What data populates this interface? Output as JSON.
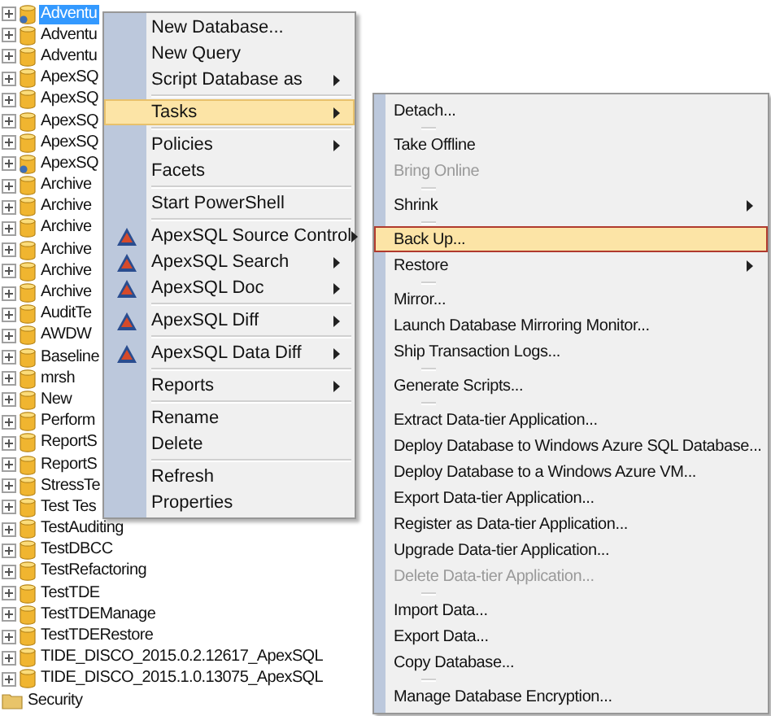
{
  "tree": [
    {
      "label": "Adventu",
      "kind": "database-linked",
      "selected": true
    },
    {
      "label": "Adventu",
      "kind": "database",
      "selected": false
    },
    {
      "label": "Adventu",
      "kind": "database",
      "selected": false
    },
    {
      "label": "ApexSQ",
      "kind": "database",
      "selected": false
    },
    {
      "label": "ApexSQ",
      "kind": "database",
      "selected": false
    },
    {
      "label": "ApexSQ",
      "kind": "database",
      "selected": false
    },
    {
      "label": "ApexSQ",
      "kind": "database",
      "selected": false
    },
    {
      "label": "ApexSQ",
      "kind": "database-linked",
      "selected": false
    },
    {
      "label": "Archive",
      "kind": "database",
      "selected": false
    },
    {
      "label": "Archive",
      "kind": "database",
      "selected": false
    },
    {
      "label": "Archive",
      "kind": "database",
      "selected": false
    },
    {
      "label": "Archive",
      "kind": "database",
      "selected": false
    },
    {
      "label": "Archive",
      "kind": "database",
      "selected": false
    },
    {
      "label": "Archive",
      "kind": "database",
      "selected": false
    },
    {
      "label": "AuditTe",
      "kind": "database",
      "selected": false
    },
    {
      "label": "AWDW",
      "kind": "database",
      "selected": false
    },
    {
      "label": "Baseline",
      "kind": "database",
      "selected": false
    },
    {
      "label": "mrsh",
      "kind": "database",
      "selected": false
    },
    {
      "label": "New",
      "kind": "database",
      "selected": false
    },
    {
      "label": "Perform",
      "kind": "database",
      "selected": false
    },
    {
      "label": "ReportS",
      "kind": "database",
      "selected": false
    },
    {
      "label": "ReportS",
      "kind": "database",
      "selected": false
    },
    {
      "label": "StressTe",
      "kind": "database",
      "selected": false
    },
    {
      "label": "Test Tes",
      "kind": "database",
      "selected": false
    },
    {
      "label": "TestAuditing",
      "kind": "database",
      "selected": false
    },
    {
      "label": "TestDBCC",
      "kind": "database",
      "selected": false
    },
    {
      "label": "TestRefactoring",
      "kind": "database",
      "selected": false
    },
    {
      "label": "TestTDE",
      "kind": "database",
      "selected": false
    },
    {
      "label": "TestTDEManage",
      "kind": "database",
      "selected": false
    },
    {
      "label": "TestTDERestore",
      "kind": "database",
      "selected": false
    },
    {
      "label": "TIDE_DISCO_2015.0.2.12617_ApexSQL",
      "kind": "database",
      "selected": false
    },
    {
      "label": "TIDE_DISCO_2015.1.0.13075_ApexSQL",
      "kind": "database",
      "selected": false
    },
    {
      "label": "Security",
      "kind": "folder",
      "selected": false
    }
  ],
  "context_menu": [
    {
      "kind": "item",
      "label": "New Database...",
      "submenu": false,
      "selected": false,
      "disabled": false,
      "icon": false
    },
    {
      "kind": "item",
      "label": "New Query",
      "submenu": false,
      "selected": false,
      "disabled": false,
      "icon": false
    },
    {
      "kind": "item",
      "label": "Script Database as",
      "submenu": true,
      "selected": false,
      "disabled": false,
      "icon": false
    },
    {
      "kind": "separator"
    },
    {
      "kind": "item",
      "label": "Tasks",
      "submenu": true,
      "selected": true,
      "disabled": false,
      "icon": false
    },
    {
      "kind": "separator"
    },
    {
      "kind": "item",
      "label": "Policies",
      "submenu": true,
      "selected": false,
      "disabled": false,
      "icon": false
    },
    {
      "kind": "item",
      "label": "Facets",
      "submenu": false,
      "selected": false,
      "disabled": false,
      "icon": false
    },
    {
      "kind": "separator"
    },
    {
      "kind": "item",
      "label": "Start PowerShell",
      "submenu": false,
      "selected": false,
      "disabled": false,
      "icon": false
    },
    {
      "kind": "separator"
    },
    {
      "kind": "item",
      "label": "ApexSQL Source Control",
      "submenu": true,
      "selected": false,
      "disabled": false,
      "icon": true
    },
    {
      "kind": "item",
      "label": "ApexSQL Search",
      "submenu": true,
      "selected": false,
      "disabled": false,
      "icon": true
    },
    {
      "kind": "item",
      "label": "ApexSQL Doc",
      "submenu": true,
      "selected": false,
      "disabled": false,
      "icon": true
    },
    {
      "kind": "separator"
    },
    {
      "kind": "item",
      "label": "ApexSQL Diff",
      "submenu": true,
      "selected": false,
      "disabled": false,
      "icon": true
    },
    {
      "kind": "separator"
    },
    {
      "kind": "item",
      "label": "ApexSQL Data Diff",
      "submenu": true,
      "selected": false,
      "disabled": false,
      "icon": true
    },
    {
      "kind": "separator"
    },
    {
      "kind": "item",
      "label": "Reports",
      "submenu": true,
      "selected": false,
      "disabled": false,
      "icon": false
    },
    {
      "kind": "separator"
    },
    {
      "kind": "item",
      "label": "Rename",
      "submenu": false,
      "selected": false,
      "disabled": false,
      "icon": false
    },
    {
      "kind": "item",
      "label": "Delete",
      "submenu": false,
      "selected": false,
      "disabled": false,
      "icon": false
    },
    {
      "kind": "separator"
    },
    {
      "kind": "item",
      "label": "Refresh",
      "submenu": false,
      "selected": false,
      "disabled": false,
      "icon": false
    },
    {
      "kind": "item",
      "label": "Properties",
      "submenu": false,
      "selected": false,
      "disabled": false,
      "icon": false
    }
  ],
  "tasks_submenu": [
    {
      "kind": "item",
      "label": "Detach...",
      "submenu": false,
      "selected": false,
      "disabled": false
    },
    {
      "kind": "separator"
    },
    {
      "kind": "item",
      "label": "Take Offline",
      "submenu": false,
      "selected": false,
      "disabled": false
    },
    {
      "kind": "item",
      "label": "Bring Online",
      "submenu": false,
      "selected": false,
      "disabled": true
    },
    {
      "kind": "separator"
    },
    {
      "kind": "item",
      "label": "Shrink",
      "submenu": true,
      "selected": false,
      "disabled": false
    },
    {
      "kind": "separator"
    },
    {
      "kind": "item",
      "label": "Back Up...",
      "submenu": false,
      "selected": true,
      "disabled": false
    },
    {
      "kind": "item",
      "label": "Restore",
      "submenu": true,
      "selected": false,
      "disabled": false
    },
    {
      "kind": "separator"
    },
    {
      "kind": "item",
      "label": "Mirror...",
      "submenu": false,
      "selected": false,
      "disabled": false
    },
    {
      "kind": "item",
      "label": "Launch Database Mirroring Monitor...",
      "submenu": false,
      "selected": false,
      "disabled": false
    },
    {
      "kind": "item",
      "label": "Ship Transaction Logs...",
      "submenu": false,
      "selected": false,
      "disabled": false
    },
    {
      "kind": "separator"
    },
    {
      "kind": "item",
      "label": "Generate Scripts...",
      "submenu": false,
      "selected": false,
      "disabled": false
    },
    {
      "kind": "separator"
    },
    {
      "kind": "item",
      "label": "Extract Data-tier Application...",
      "submenu": false,
      "selected": false,
      "disabled": false
    },
    {
      "kind": "item",
      "label": "Deploy Database to Windows Azure SQL Database...",
      "submenu": false,
      "selected": false,
      "disabled": false
    },
    {
      "kind": "item",
      "label": "Deploy Database to a Windows Azure VM...",
      "submenu": false,
      "selected": false,
      "disabled": false
    },
    {
      "kind": "item",
      "label": "Export Data-tier Application...",
      "submenu": false,
      "selected": false,
      "disabled": false
    },
    {
      "kind": "item",
      "label": "Register as Data-tier Application...",
      "submenu": false,
      "selected": false,
      "disabled": false
    },
    {
      "kind": "item",
      "label": "Upgrade Data-tier Application...",
      "submenu": false,
      "selected": false,
      "disabled": false
    },
    {
      "kind": "item",
      "label": "Delete Data-tier Application...",
      "submenu": false,
      "selected": false,
      "disabled": true
    },
    {
      "kind": "separator"
    },
    {
      "kind": "item",
      "label": "Import Data...",
      "submenu": false,
      "selected": false,
      "disabled": false
    },
    {
      "kind": "item",
      "label": "Export Data...",
      "submenu": false,
      "selected": false,
      "disabled": false
    },
    {
      "kind": "item",
      "label": "Copy Database...",
      "submenu": false,
      "selected": false,
      "disabled": false
    },
    {
      "kind": "separator"
    },
    {
      "kind": "item",
      "label": "Manage Database Encryption...",
      "submenu": false,
      "selected": false,
      "disabled": false
    }
  ]
}
